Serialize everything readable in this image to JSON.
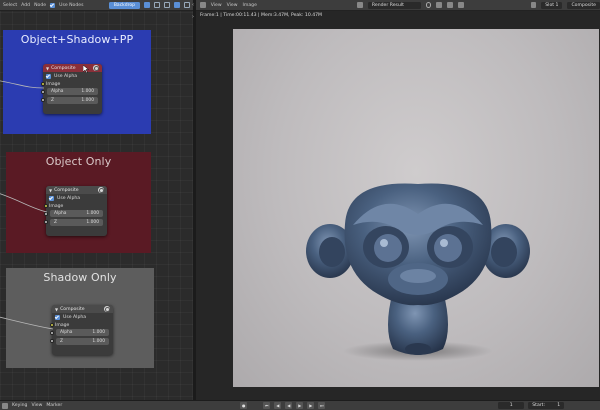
{
  "node_editor": {
    "header": {
      "menus": [
        "Select",
        "Add",
        "Node"
      ],
      "use_nodes_label": "Use Nodes",
      "backdrop_label": "Backdrop"
    },
    "frames": [
      {
        "title": "Object+Shadow+PP",
        "color": "#2b3cb1",
        "node": {
          "title": "Composite",
          "use_alpha": "Use Alpha",
          "image": "Image",
          "alpha_label": "Alpha",
          "alpha_value": "1.000",
          "z_label": "Z",
          "z_value": "1.000"
        }
      },
      {
        "title": "Object Only",
        "color": "#5a1a24",
        "node": {
          "title": "Composite",
          "use_alpha": "Use Alpha",
          "image": "Image",
          "alpha_label": "Alpha",
          "alpha_value": "1.000",
          "z_label": "Z",
          "z_value": "1.000"
        }
      },
      {
        "title": "Shadow Only",
        "color": "#5d5d5d",
        "node": {
          "title": "Composite",
          "use_alpha": "Use Alpha",
          "image": "Image",
          "alpha_label": "Alpha",
          "alpha_value": "1.000",
          "z_label": "Z",
          "z_value": "1.000"
        }
      }
    ]
  },
  "image_editor": {
    "header": {
      "menus": [
        "View",
        "View",
        "Image"
      ],
      "image_name": "Render Result",
      "slot": "Slot 1",
      "pass": "Composite"
    },
    "render_info": "Frame:1 | Time:00:11.43 | Mem:3.47M, Peak: 10.47M"
  },
  "timeline": {
    "view": "View",
    "marker": "Marker",
    "keying": "Keying",
    "current_frame": "1",
    "start_label": "Start:",
    "start_value": "1"
  },
  "colors": {
    "accent": "#5a8fd6",
    "socket_yellow": "#d5d14a",
    "monkey": "#4a6180"
  }
}
